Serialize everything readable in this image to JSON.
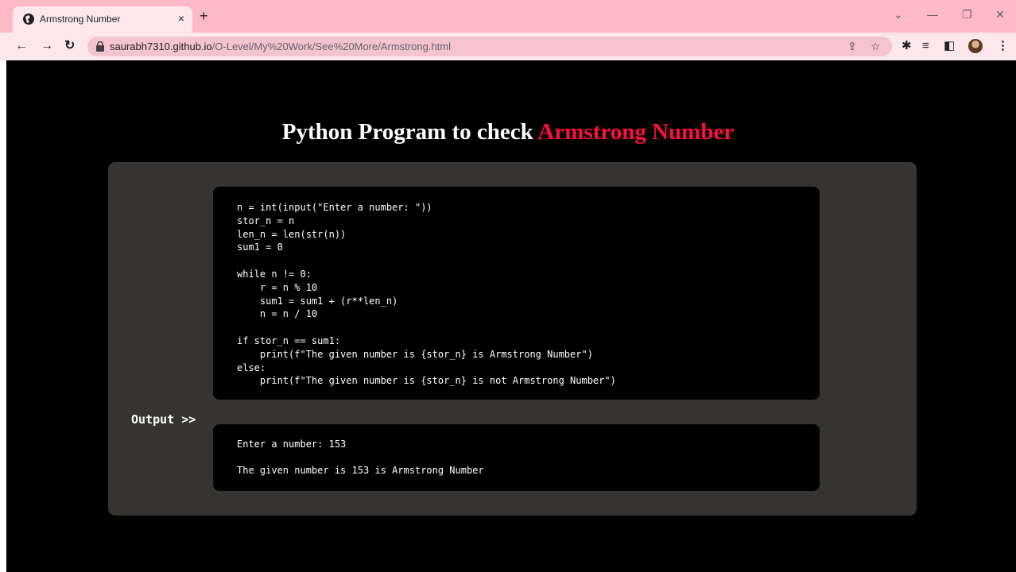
{
  "browser": {
    "tab_title": "Armstrong Number",
    "tab_close": "×",
    "new_tab": "+",
    "url_host": "saurabh7310.github.io",
    "url_path": "/O-Level/My%20Work/See%20More/Armstrong.html",
    "icons": [
      "back-icon",
      "forward-icon",
      "reload-icon",
      "lock-icon",
      "share-icon",
      "star-icon",
      "extensions-icon",
      "reading-list-icon",
      "side-panel-icon",
      "avatar",
      "menu-icon"
    ]
  },
  "page": {
    "title_main": "Python Program to check ",
    "title_accent": "Armstrong Number",
    "accent_color": "#ff0e3d",
    "code": "n = int(input(\"Enter a number: \"))\nstor_n = n\nlen_n = len(str(n))\nsum1 = 0\n\nwhile n != 0:\n    r = n % 10\n    sum1 = sum1 + (r**len_n)\n    n = n / 10\n\nif stor_n == sum1:\n    print(f\"The given number is {stor_n} is Armstrong Number\")\nelse:\n    print(f\"The given number is {stor_n} is not Armstrong Number\")",
    "output_label": "Output >>",
    "output_lines": [
      "Enter a number: 153",
      "The given number is 153 is Armstrong Number"
    ]
  }
}
